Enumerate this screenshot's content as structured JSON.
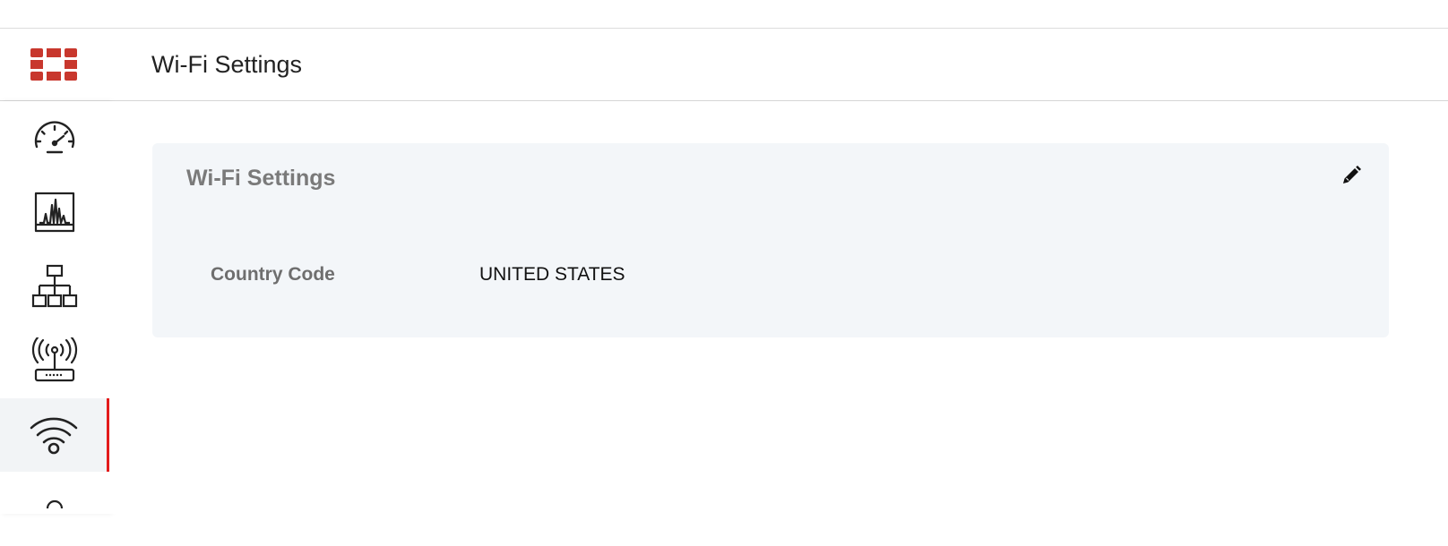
{
  "header": {
    "title": "Wi-Fi Settings",
    "logo_icon": "fortinet-logo-icon",
    "brand_color": "#c8372d"
  },
  "sidebar": {
    "active_indicator_color": "#e31b1b",
    "items": [
      {
        "icon": "dashboard-gauge-icon",
        "active": false
      },
      {
        "icon": "monitor-chart-icon",
        "active": false
      },
      {
        "icon": "network-topology-icon",
        "active": false
      },
      {
        "icon": "access-point-icon",
        "active": false
      },
      {
        "icon": "wifi-icon",
        "active": true
      }
    ]
  },
  "card": {
    "title": "Wi-Fi Settings",
    "edit_icon": "pencil-icon",
    "fields": [
      {
        "label": "Country Code",
        "value": "UNITED STATES"
      }
    ]
  }
}
